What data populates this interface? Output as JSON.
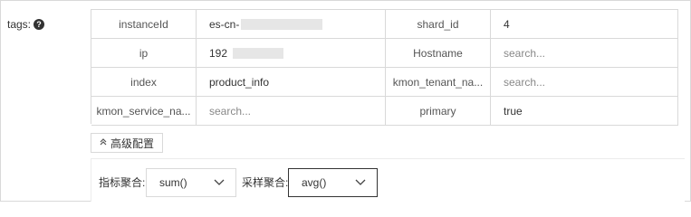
{
  "tags_label": "tags:",
  "help_icon_glyph": "?",
  "tags": [
    [
      {
        "key": "instanceId",
        "value": "es-cn-",
        "masked": true
      },
      {
        "key": "shard_id",
        "value": "4",
        "masked": false
      }
    ],
    [
      {
        "key": "ip",
        "value": "192",
        "masked": true
      },
      {
        "key": "Hostname",
        "value": "",
        "placeholder": "search..."
      }
    ],
    [
      {
        "key": "index",
        "value": "product_info",
        "masked": false
      },
      {
        "key": "kmon_tenant_na...",
        "value": "",
        "placeholder": "search..."
      }
    ],
    [
      {
        "key": "kmon_service_na...",
        "value": "",
        "placeholder": "search..."
      },
      {
        "key": "primary",
        "value": "true",
        "masked": false
      }
    ]
  ],
  "advanced_button": {
    "label": "高级配置",
    "icon": "chevron-up-double-icon"
  },
  "aggregation": {
    "metric_label": "指标聚合:",
    "metric_value": "sum()",
    "sample_label": "采样聚合:",
    "sample_value": "avg()"
  },
  "colors": {
    "border": "#d9d9d9",
    "text": "#333333",
    "placeholder": "#888888"
  }
}
